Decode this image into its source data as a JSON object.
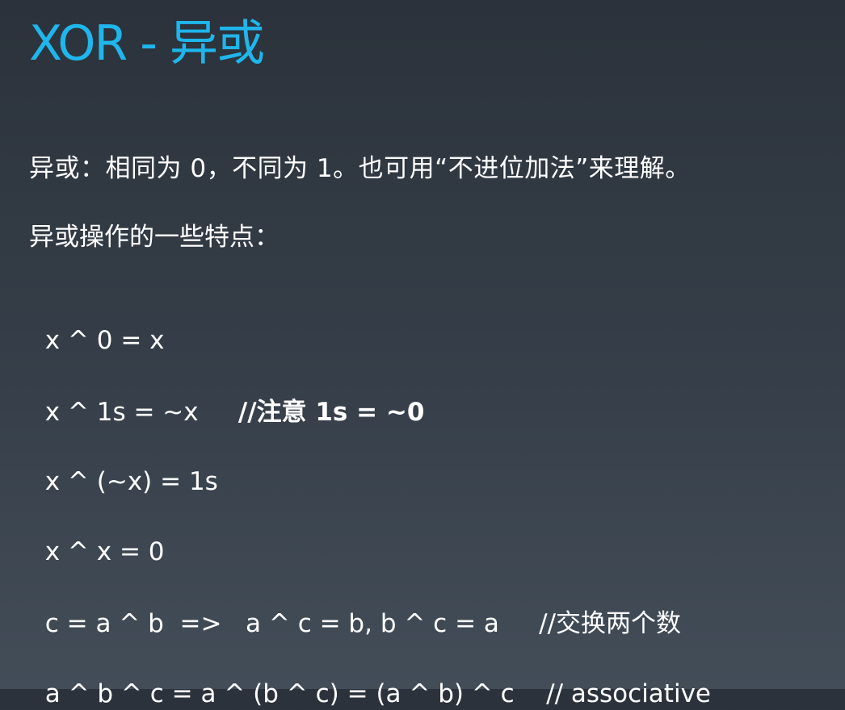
{
  "slide": {
    "title": "XOR - 异或",
    "definition": "异或：相同为 0，不同为 1。也可用“不进位加法”来理解。",
    "features_heading": "异或操作的一些特点：",
    "properties": [
      {
        "expr": "x ^ 0 = x",
        "comment": ""
      },
      {
        "expr": "x ^ 1s = ~x     ",
        "comment": "//注意 1s = ~0"
      },
      {
        "expr": "x ^ (~x) = 1s",
        "comment": ""
      },
      {
        "expr": "x ^ x = 0",
        "comment": ""
      },
      {
        "expr": "c = a ^ b  =>   a ^ c = b, b ^ c = a     ",
        "comment": "//交换两个数"
      },
      {
        "expr": "a ^ b ^ c = a ^ (b ^ c) = (a ^ b) ^ c    ",
        "comment": "// associative"
      }
    ]
  }
}
